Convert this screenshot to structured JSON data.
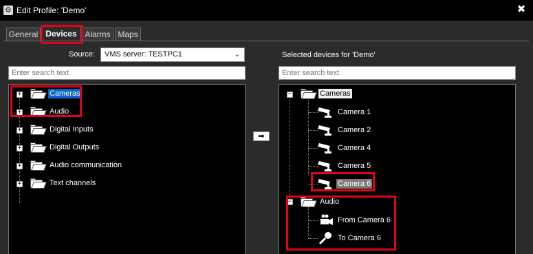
{
  "window": {
    "title": "Edit Profile: 'Demo'",
    "close_glyph": "✖"
  },
  "tabs": [
    {
      "label": "General",
      "active": false
    },
    {
      "label": "Devices",
      "active": true
    },
    {
      "label": "Alarms",
      "active": false
    },
    {
      "label": "Maps",
      "active": false
    }
  ],
  "source": {
    "label": "Source:",
    "value": "VMS server: TESTPC1"
  },
  "left_panel": {
    "search_placeholder": "Enter search text",
    "items": [
      {
        "label": "Cameras",
        "selected": true
      },
      {
        "label": "Audio"
      },
      {
        "label": "Digital Inputs"
      },
      {
        "label": "Digital Outputs"
      },
      {
        "label": "Audio communication"
      },
      {
        "label": "Text channels"
      }
    ]
  },
  "move_button": {
    "glyph": "➡"
  },
  "right_panel": {
    "heading": "Selected devices for 'Demo'",
    "search_placeholder": "Enter search text",
    "cameras": {
      "label": "Cameras",
      "children": [
        "Camera 1",
        "Camera 2",
        "Camera 4",
        "Camera 5",
        "Camera 6"
      ]
    },
    "audio": {
      "label": "Audio",
      "children": [
        "From Camera 6",
        "To Camera 6"
      ]
    }
  },
  "colors": {
    "highlight_red": "#e2001a",
    "selection_blue": "#0a64c8"
  }
}
